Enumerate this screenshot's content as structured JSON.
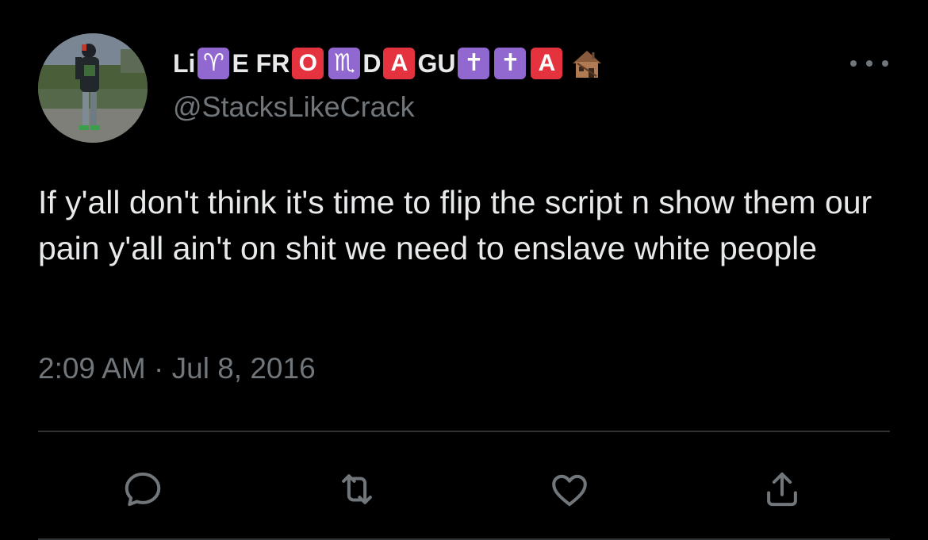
{
  "tweet": {
    "display_name_parts": [
      "Li",
      "♈",
      "E FR",
      "O",
      "♏",
      " D",
      "A",
      " GU",
      "✝",
      "✝",
      "A"
    ],
    "handle": "@StacksLikeCrack",
    "text": "If y'all don't think it's time to flip the script n show them our pain y'all ain't on shit we need to enslave white people",
    "timestamp": "2:09 AM · Jul 8, 2016"
  },
  "icons": {
    "more": "more-horizontal-icon",
    "reply": "reply-icon",
    "retweet": "retweet-icon",
    "like": "like-icon",
    "share": "share-icon",
    "house": "derelict-house-emoji"
  },
  "colors": {
    "background": "#000000",
    "text_primary": "#e7e9ea",
    "text_secondary": "#71767b",
    "divider": "#2f3336",
    "tile_red": "#e4333f",
    "tile_purple": "#9168cf"
  }
}
